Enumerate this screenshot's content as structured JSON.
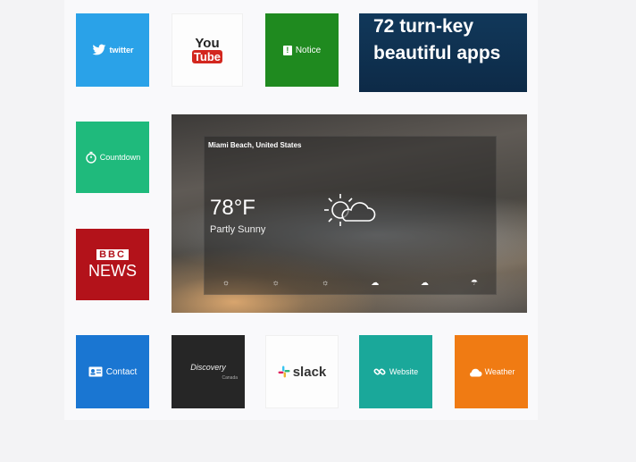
{
  "tiles": {
    "twitter": {
      "label": "twitter",
      "color": "#2aa2e8"
    },
    "youtube": {
      "label_top": "You",
      "label_bottom": "Tube"
    },
    "notice": {
      "label": "Notice",
      "color": "#1f8a1f"
    },
    "promo": {
      "text": "72 turn-key beautiful apps"
    },
    "countdown": {
      "label": "Countdown",
      "color": "#1fba7c"
    },
    "bbc": {
      "top": "BBC",
      "bottom": "NEWS",
      "color": "#b3121a"
    },
    "contact": {
      "label": "Contact",
      "color": "#1a76d2"
    },
    "discovery": {
      "label": "Discovery",
      "sub": "Canada"
    },
    "slack": {
      "label": "slack"
    },
    "website": {
      "label": "Website",
      "color": "#1aa89a"
    },
    "weather_app": {
      "label": "Weather",
      "color": "#f07b13"
    }
  },
  "weather": {
    "location": "Miami Beach, United States",
    "temp": "78°F",
    "condition": "Partly Sunny",
    "icon": "partly-sunny-icon"
  }
}
